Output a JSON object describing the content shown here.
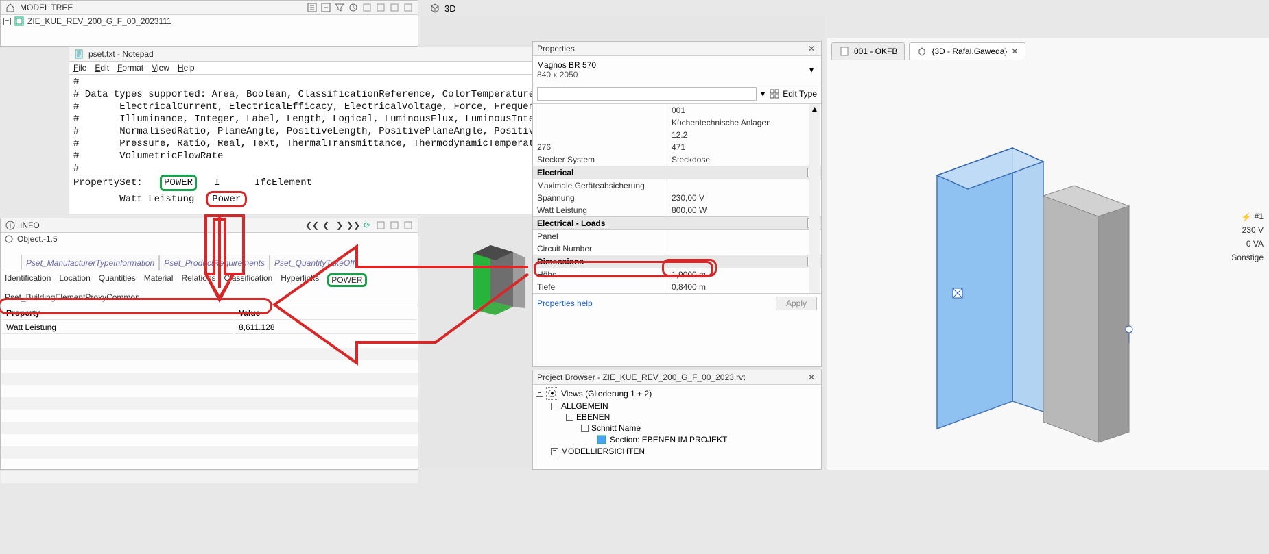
{
  "modeltree": {
    "title": "MODEL TREE",
    "file": "ZIE_KUE_REV_200_G_F_00_2023111"
  },
  "viewport_tab": "3D",
  "notepad": {
    "title": "pset.txt - Notepad",
    "menu": {
      "file": "File",
      "edit": "Edit",
      "format": "Format",
      "view": "View",
      "help": "Help"
    },
    "body_pre": "#\n# Data types supported: Area, Boolean, ClassificationReference, ColorTemperature, Count, Currency,\n#       ElectricalCurrent, ElectricalEfficacy, ElectricalVoltage, Force, Frequency, Identifier,\n#       Illuminance, Integer, Label, Length, Logical, LuminousFlux, LuminousIntensity,\n#       NormalisedRatio, PlaneAngle, PositiveLength, PositivePlaneAngle, PositiveRatio, Power,\n#       Pressure, Ratio, Real, Text, ThermalTransmittance, ThermodynamicTemperature, Volume,\n#       VolumetricFlowRate\n#\nPropertySet:   ",
    "pset_name": "POWER",
    "mid": "   I      IfcElement\n        Watt Leistung  ",
    "prop_type": "Power"
  },
  "info": {
    "title": "INFO",
    "object": "Object.-1.5",
    "catTabs": [
      "Pset_ManufacturerTypeInformation",
      "Pset_ProductRequirements",
      "Pset_QuantityTakeOff"
    ],
    "subTabs": [
      "Identification",
      "Location",
      "Quantities",
      "Material",
      "Relations",
      "Classification",
      "Hyperlinks",
      "POWER",
      "Pset_BuildingElementProxyCommon"
    ],
    "colProp": "Property",
    "colVal": "Value",
    "rowKey": "Watt Leistung",
    "rowVal": "8,611.128"
  },
  "props": {
    "title": "Properties",
    "type_line1": "Magnos BR 570",
    "type_line2": "840 x 2050",
    "editType": "Edit Type",
    "rowsTop": [
      {
        "k": "",
        "v": "001"
      },
      {
        "k": "",
        "v": "Küchentechnische Anlagen"
      },
      {
        "k": "",
        "v": "12.2"
      },
      {
        "k": "276",
        "v": "471"
      }
    ],
    "groups": [
      {
        "name": "Stecker System",
        "single": "Steckdose"
      },
      {
        "name": "Electrical",
        "rows": [
          {
            "k": "Maximale Geräteabsicherung",
            "v": ""
          },
          {
            "k": "Spannung",
            "v": "230,00 V"
          },
          {
            "k": "Watt Leistung",
            "v": "800,00 W",
            "hl": true
          }
        ]
      },
      {
        "name": "Electrical - Loads",
        "rows": [
          {
            "k": "Panel",
            "v": ""
          },
          {
            "k": "Circuit Number",
            "v": ""
          }
        ]
      },
      {
        "name": "Dimensions",
        "rows": [
          {
            "k": "Höhe",
            "v": "1,9000 m"
          },
          {
            "k": "Tiefe",
            "v": "0,8400 m"
          }
        ]
      }
    ],
    "help": "Properties help",
    "apply": "Apply"
  },
  "browser": {
    "title": "Project Browser - ZIE_KUE_REV_200_G_F_00_2023.rvt",
    "nodes": {
      "views": "Views (Gliederung 1 + 2)",
      "allgemein": "ALLGEMEIN",
      "ebenen": "EBENEN",
      "schnitt": "Schnitt Name",
      "section": "Section: EBENEN IM PROJEKT",
      "modell": "MODELLIERSICHTEN"
    }
  },
  "tabs3d": {
    "t1": "001 - OKFB",
    "t2": "{3D - Rafal.Gaweda}"
  },
  "status3d": {
    "l1": "#1",
    "l2": "230 V",
    "l3": "0 VA",
    "l4": "Sonstige"
  }
}
